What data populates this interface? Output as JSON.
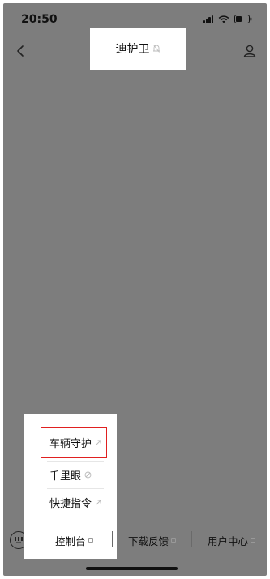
{
  "status_bar": {
    "time": "20:50"
  },
  "nav": {
    "title": "迪护卫",
    "back_icon": "chevron-left-icon",
    "user_icon": "user-icon",
    "title_icon": "bell-icon"
  },
  "popup_menu": {
    "items": [
      {
        "label": "车辆守护",
        "selected": true
      },
      {
        "label": "千里眼",
        "selected": false
      },
      {
        "label": "快捷指令",
        "selected": false
      }
    ]
  },
  "tab_bar": {
    "tabs": [
      {
        "label": "控制台"
      },
      {
        "label": "下载反馈"
      },
      {
        "label": "用户中心"
      }
    ]
  },
  "colors": {
    "overlay": "#7d7d7d",
    "selected_border": "#e02020",
    "surface": "#ffffff"
  }
}
